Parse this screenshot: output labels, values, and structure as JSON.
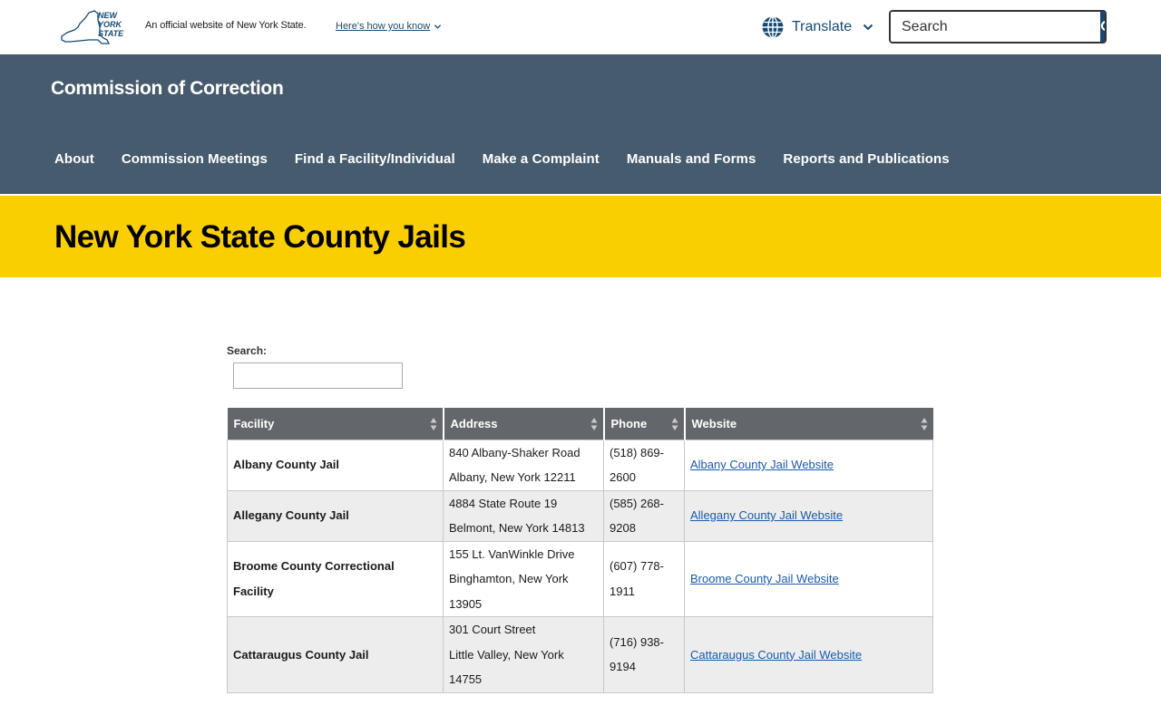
{
  "topbar": {
    "logo_alt": "NEW YORK STATE",
    "official_text": "An official website of New York State.",
    "how_know": "Here's how you know",
    "translate": "Translate",
    "search_placeholder": "Search"
  },
  "agency": {
    "name": "Commission of Correction",
    "nav": [
      "About",
      "Commission Meetings",
      "Find a Facility/Individual",
      "Make a Complaint",
      "Manuals and Forms",
      "Reports and Publications"
    ]
  },
  "page": {
    "title": "New York State County Jails",
    "search_label": "Search:"
  },
  "table": {
    "headers": [
      "Facility",
      "Address",
      "Phone",
      "Website"
    ],
    "rows": [
      {
        "facility": "Albany County Jail",
        "address": [
          "840 Albany-Shaker Road",
          "Albany, New York 12211"
        ],
        "phone": [
          "(518) 869-",
          "2600"
        ],
        "website": "Albany County Jail Website"
      },
      {
        "facility": "Allegany County Jail",
        "address": [
          "4884 State Route 19",
          "Belmont, New York 14813"
        ],
        "phone": [
          "(585) 268-",
          "9208"
        ],
        "website": "Allegany County Jail Website"
      },
      {
        "facility": "Broome County Correctional Facility",
        "address": [
          "155 Lt. VanWinkle Drive",
          "Binghamton, New York",
          "13905"
        ],
        "phone": [
          "(607) 778-",
          "1911"
        ],
        "website": "Broome County Jail Website"
      },
      {
        "facility": "Cattaraugus County Jail",
        "address": [
          "301 Court Street",
          "Little Valley, New York",
          "14755"
        ],
        "phone": [
          "(716) 938-",
          "9194"
        ],
        "website": "Cattaraugus County Jail Website"
      }
    ]
  },
  "colors": {
    "agency_bar": "#465b6e",
    "title_band": "#facf01",
    "link": "#154973",
    "table_header": "#63676b"
  }
}
